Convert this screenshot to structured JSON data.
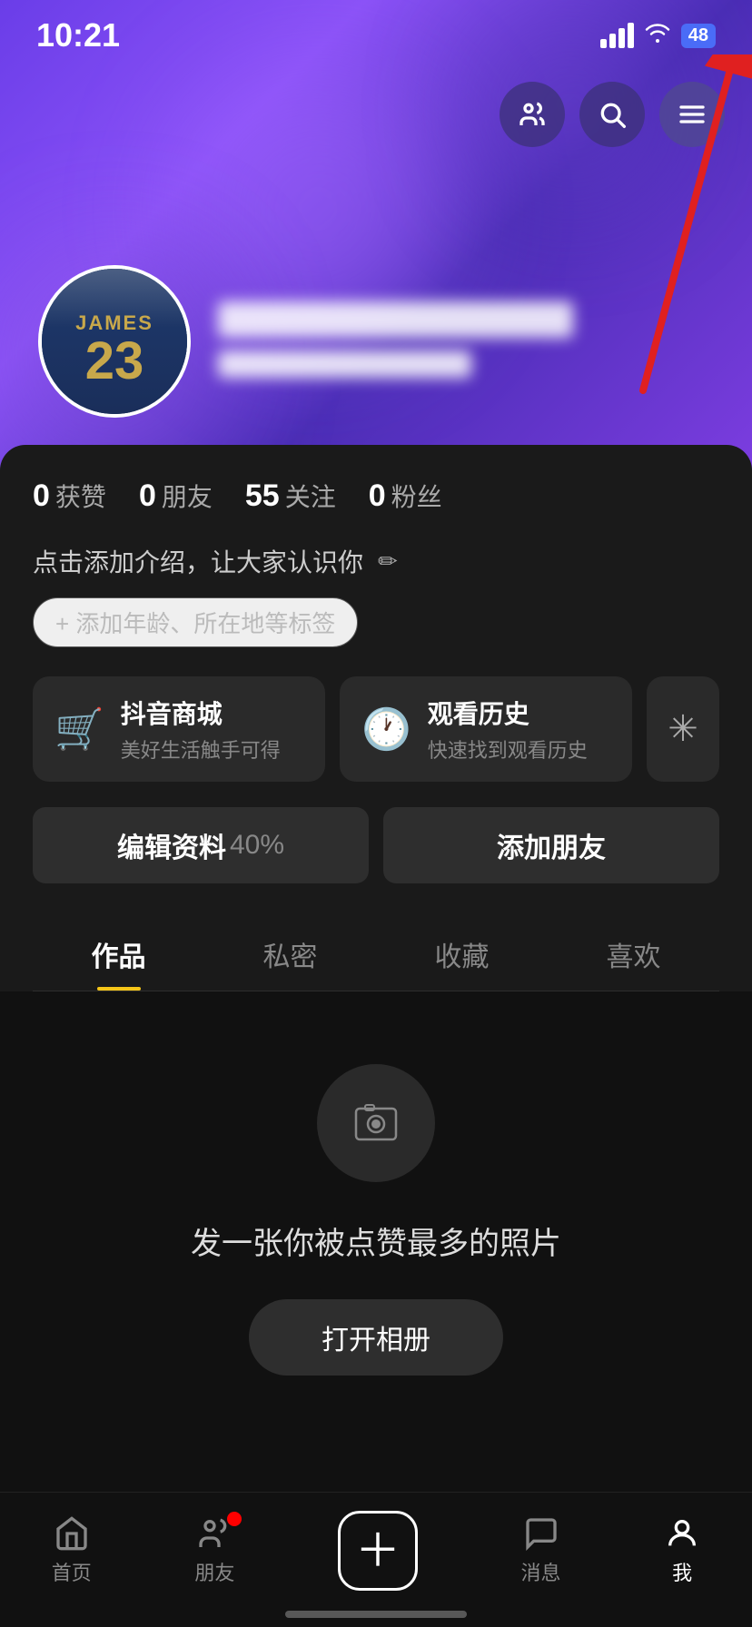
{
  "statusBar": {
    "time": "10:21",
    "battery": "48"
  },
  "topActions": {
    "friendsLabel": "friends",
    "searchLabel": "search",
    "menuLabel": "menu"
  },
  "profile": {
    "avatarName": "JAMES",
    "avatarNumber": "23",
    "usernamePlaceholder": "已隐藏用户名",
    "userId": "抖音号: cvi g"
  },
  "stats": [
    {
      "number": "0",
      "label": "获赞"
    },
    {
      "number": "0",
      "label": "朋友"
    },
    {
      "number": "55",
      "label": "关注"
    },
    {
      "number": "0",
      "label": "粉丝"
    }
  ],
  "bio": {
    "text": "点击添加介绍，让大家认识你",
    "editIcon": "✏"
  },
  "tagButton": {
    "label": "+ 添加年龄、所在地等标签"
  },
  "shortcuts": [
    {
      "icon": "🛒",
      "title": "抖音商城",
      "subtitle": "美好生活触手可得"
    },
    {
      "icon": "🕐",
      "title": "观看历史",
      "subtitle": "快速找到观看历史"
    }
  ],
  "actionButtons": [
    {
      "label": "编辑资料",
      "suffix": "40%",
      "id": "edit-profile"
    },
    {
      "label": "添加朋友",
      "id": "add-friend"
    }
  ],
  "tabs": [
    {
      "label": "作品",
      "active": true
    },
    {
      "label": "私密",
      "active": false
    },
    {
      "label": "收藏",
      "active": false
    },
    {
      "label": "喜欢",
      "active": false
    }
  ],
  "emptyState": {
    "title": "发一张你被点赞最多的照片",
    "buttonLabel": "打开相册"
  },
  "bottomNav": [
    {
      "label": "首页",
      "active": false
    },
    {
      "label": "朋友",
      "active": false,
      "dot": true
    },
    {
      "label": "",
      "isAdd": true
    },
    {
      "label": "消息",
      "active": false
    },
    {
      "label": "我",
      "active": true
    }
  ]
}
